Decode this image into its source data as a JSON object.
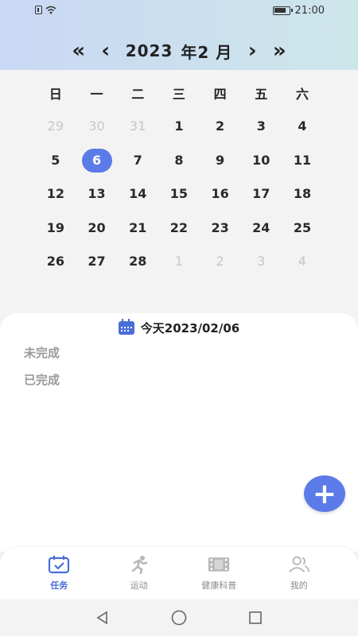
{
  "status_bar": {
    "time": "21:00"
  },
  "header": {
    "year": "2023",
    "month_label": "年2 月",
    "prev_year_glyph": "«",
    "prev_month_glyph": "‹",
    "next_month_glyph": "›",
    "next_year_glyph": "»"
  },
  "calendar": {
    "weekdays": [
      "日",
      "一",
      "二",
      "三",
      "四",
      "五",
      "六"
    ],
    "weeks": [
      [
        {
          "d": "29",
          "other": true
        },
        {
          "d": "30",
          "other": true
        },
        {
          "d": "31",
          "other": true
        },
        {
          "d": "1"
        },
        {
          "d": "2"
        },
        {
          "d": "3"
        },
        {
          "d": "4"
        }
      ],
      [
        {
          "d": "5"
        },
        {
          "d": "6",
          "selected": true
        },
        {
          "d": "7"
        },
        {
          "d": "8"
        },
        {
          "d": "9"
        },
        {
          "d": "10"
        },
        {
          "d": "11"
        }
      ],
      [
        {
          "d": "12"
        },
        {
          "d": "13"
        },
        {
          "d": "14"
        },
        {
          "d": "15"
        },
        {
          "d": "16"
        },
        {
          "d": "17"
        },
        {
          "d": "18"
        }
      ],
      [
        {
          "d": "19"
        },
        {
          "d": "20"
        },
        {
          "d": "21"
        },
        {
          "d": "22"
        },
        {
          "d": "23"
        },
        {
          "d": "24"
        },
        {
          "d": "25"
        }
      ],
      [
        {
          "d": "26"
        },
        {
          "d": "27"
        },
        {
          "d": "28"
        },
        {
          "d": "1",
          "other": true
        },
        {
          "d": "2",
          "other": true
        },
        {
          "d": "3",
          "other": true
        },
        {
          "d": "4",
          "other": true
        }
      ]
    ]
  },
  "tasks": {
    "today_label": "今天2023/02/06",
    "incomplete_label": "未完成",
    "completed_label": "已完成",
    "add_glyph": "+"
  },
  "tabs": [
    {
      "label": "任务",
      "icon": "task-calendar-icon",
      "active": true
    },
    {
      "label": "运动",
      "icon": "running-icon",
      "active": false
    },
    {
      "label": "健康科普",
      "icon": "film-icon",
      "active": false
    },
    {
      "label": "我的",
      "icon": "users-icon",
      "active": false
    }
  ],
  "colors": {
    "accent": "#5b7be8",
    "selected_day": "#5b7be8",
    "header_gradient_start": "#c9d8f4",
    "header_gradient_end": "#cde6ea"
  }
}
